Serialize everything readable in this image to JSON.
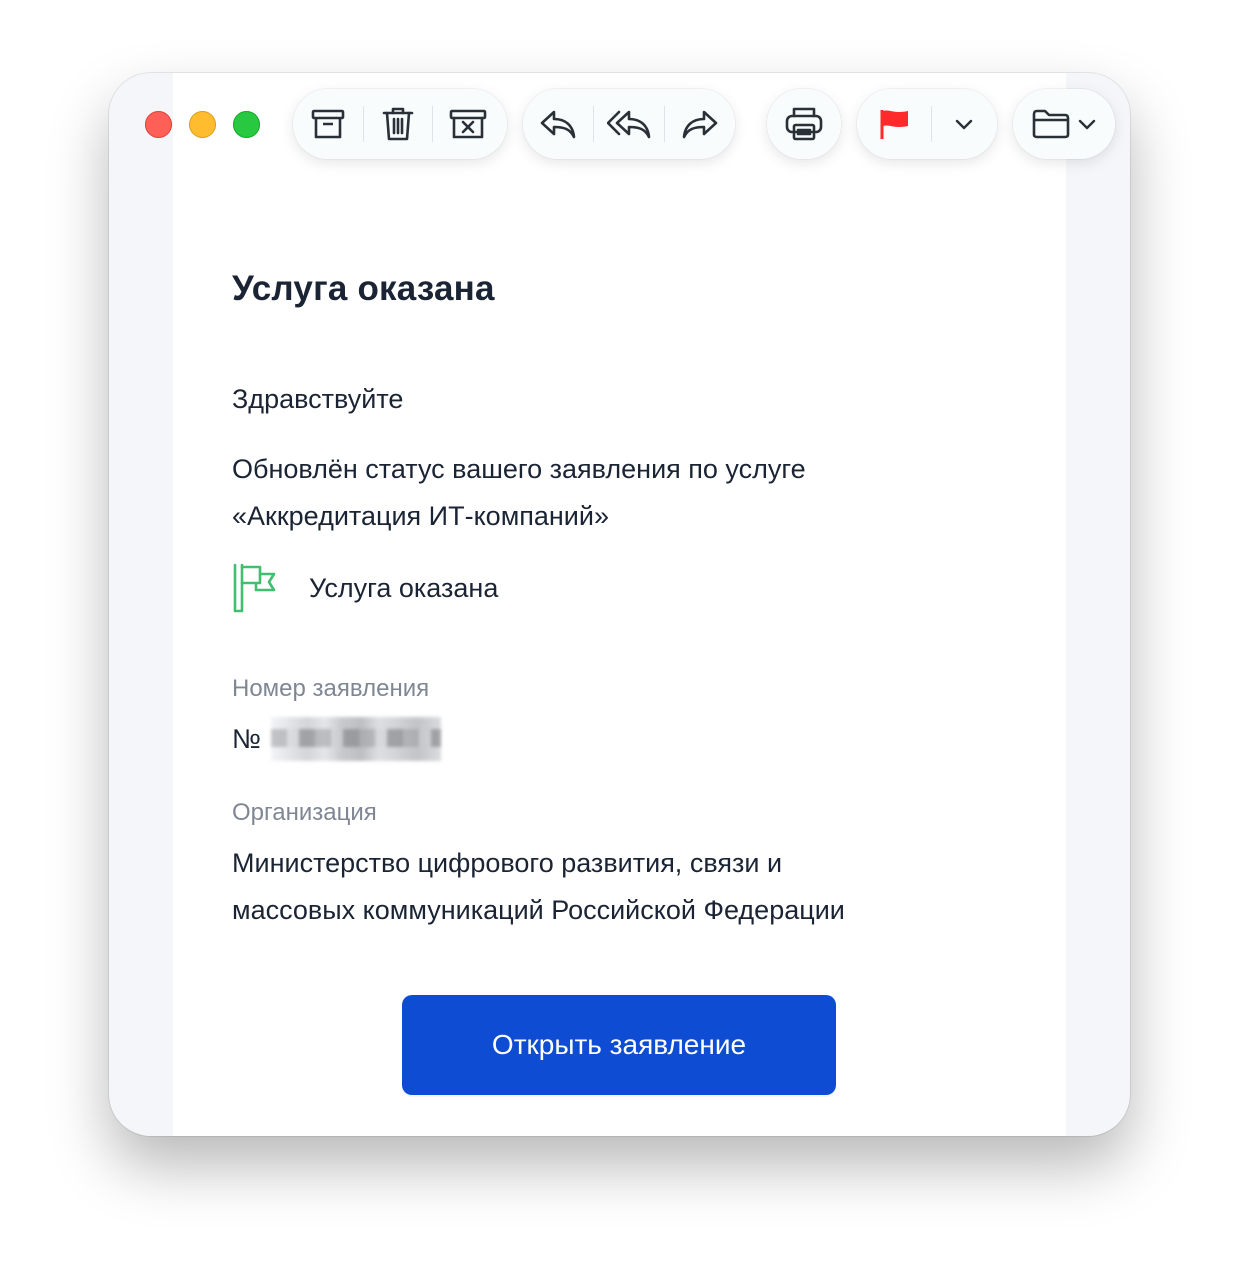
{
  "toolbar": {
    "icons": [
      "archive-icon",
      "trash-icon",
      "junk-icon",
      "reply-icon",
      "reply-all-icon",
      "forward-icon",
      "print-icon",
      "flag-icon",
      "chevron-down-icon",
      "folder-icon"
    ],
    "flag_color": "#ff2a2a"
  },
  "email": {
    "title": "Услуга оказана",
    "greeting": "Здравствуйте",
    "status_message_line1": "Обновлён статус вашего заявления по услуге",
    "status_message_line2": "«Аккредитация ИТ-компаний»",
    "status_label": "Услуга оказана",
    "status_icon": "green-flag-icon",
    "status_icon_color": "#3fbf6f",
    "application_number_caption": "Номер заявления",
    "application_number_prefix": "№",
    "organization_caption": "Организация",
    "organization_line1": "Министерство цифрового развития, связи и",
    "organization_line2": "массовых коммуникаций Российской Федерации",
    "open_button_label": "Открыть заявление",
    "button_color": "#0d4cd3"
  }
}
